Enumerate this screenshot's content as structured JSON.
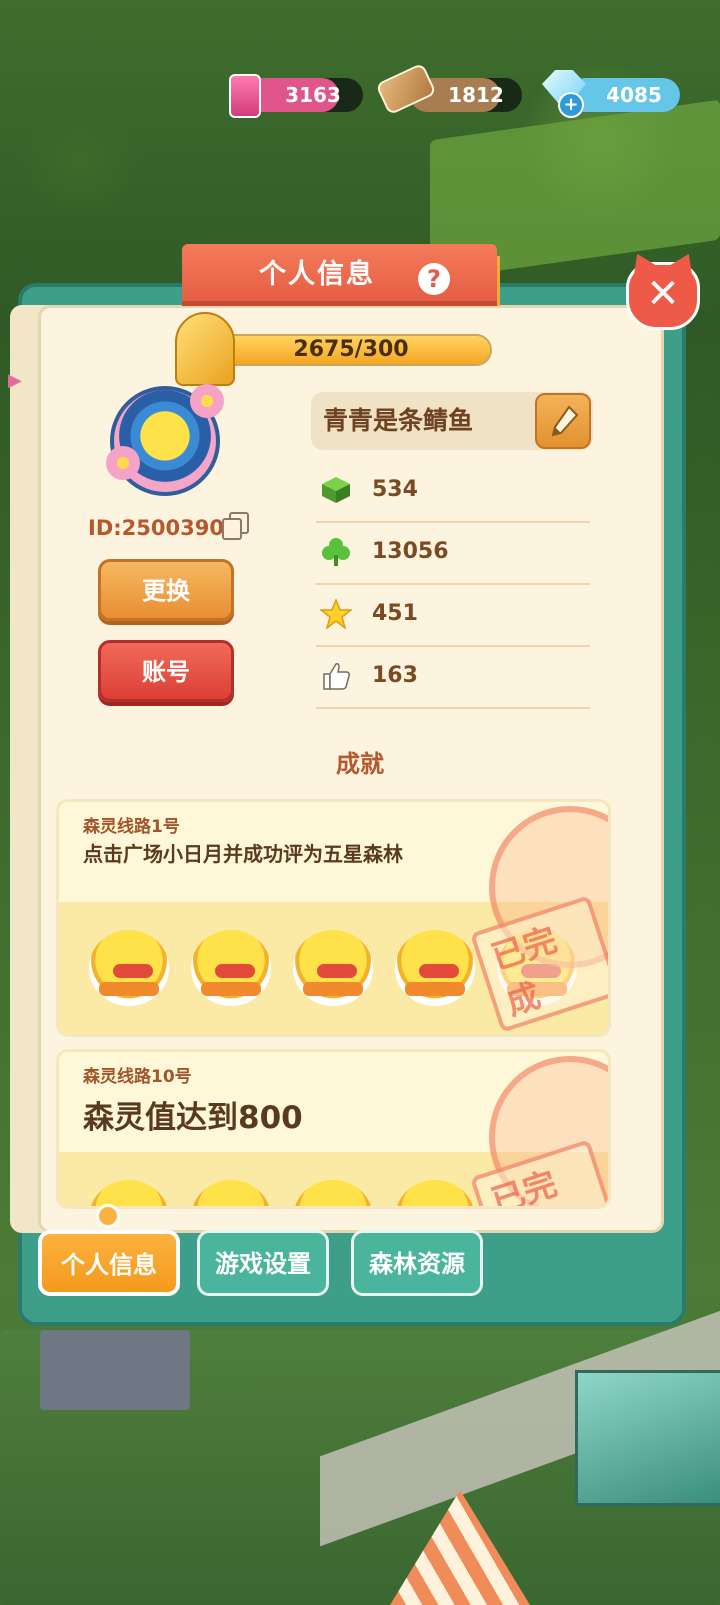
{
  "resources": {
    "ink": "3163",
    "wood": "1812",
    "gem": "4085"
  },
  "panel": {
    "title": "个人信息",
    "help_icon": "?",
    "close_icon": "✕"
  },
  "level": {
    "progress_text": "2675/300",
    "fill_fraction": 1.0
  },
  "profile": {
    "id_text": "ID:25003901",
    "name": "青青是条鲭鱼",
    "change_label": "更换",
    "account_label": "账号"
  },
  "stats": [
    {
      "icon": "grass-block-icon",
      "value": "534"
    },
    {
      "icon": "clover-icon",
      "value": "13056"
    },
    {
      "icon": "star-icon",
      "value": "451"
    },
    {
      "icon": "thumbs-up-icon",
      "value": "163"
    }
  ],
  "achievements": {
    "title": "成就",
    "items": [
      {
        "route": "森灵线路1号",
        "desc": "点击广场小日月并成功评为五星森林",
        "stamp": "已完成"
      },
      {
        "route": "森灵线路10号",
        "desc": "森灵值达到800",
        "stamp": "已完成"
      }
    ]
  },
  "tabs": [
    {
      "label": "个人信息",
      "active": true
    },
    {
      "label": "游戏设置",
      "active": false
    },
    {
      "label": "森林资源",
      "active": false
    }
  ],
  "colors": {
    "panel_teal": "#3d9e8a",
    "banner_red": "#e35c43",
    "tab_active": "#f39a1c",
    "page_bg": "#fcf4df"
  }
}
